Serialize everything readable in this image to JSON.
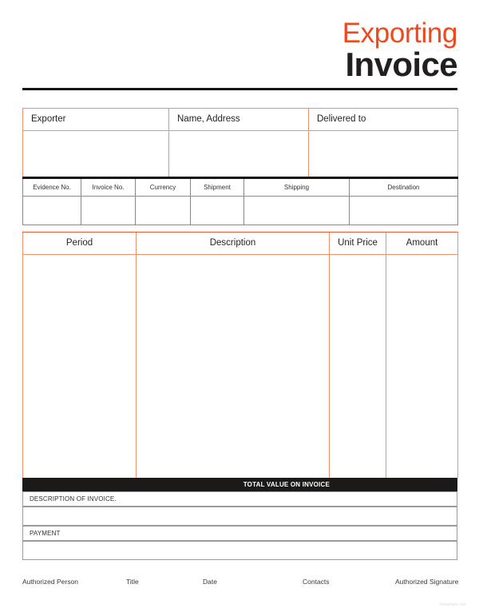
{
  "document": {
    "title_line1": "Exporting",
    "title_line2": "Invoice",
    "accent_color": "#F0481E",
    "border_color": "#F2916C",
    "meta_border_color": "#8A8A8A",
    "dark_color": "#1B1A18",
    "watermark": "Template.net"
  },
  "parties": {
    "columns": [
      {
        "label": "Exporter",
        "value": ""
      },
      {
        "label": "Name, Address",
        "value": ""
      },
      {
        "label": "Delivered to",
        "value": ""
      }
    ]
  },
  "shipment_meta": {
    "columns": [
      {
        "label": "Evidence No.",
        "value": ""
      },
      {
        "label": "Invoice No.",
        "value": ""
      },
      {
        "label": "Currency",
        "value": ""
      },
      {
        "label": "Shipment",
        "value": ""
      },
      {
        "label": "Shipping",
        "value": ""
      },
      {
        "label": "Destination",
        "value": ""
      }
    ]
  },
  "line_items": {
    "columns": [
      {
        "label": "Period",
        "value": ""
      },
      {
        "label": "Description",
        "value": ""
      },
      {
        "label": "Unit Price",
        "value": ""
      },
      {
        "label": "Amount",
        "value": ""
      }
    ]
  },
  "total": {
    "label": "TOTAL VALUE ON INVOICE",
    "value": ""
  },
  "notes": [
    {
      "label": "DESCRIPTION OF INVOICE.",
      "value": ""
    },
    {
      "label": "PAYMENT",
      "value": ""
    }
  ],
  "footer": {
    "fields": [
      {
        "label": "Authorized Person"
      },
      {
        "label": "Title"
      },
      {
        "label": "Date"
      },
      {
        "label": "Contacts"
      },
      {
        "label": "Authorized Signature"
      }
    ]
  }
}
